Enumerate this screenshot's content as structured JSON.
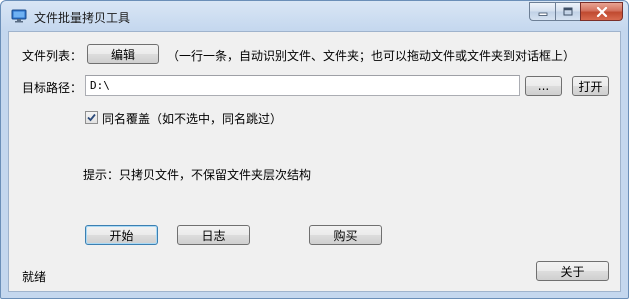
{
  "window": {
    "title": "文件批量拷贝工具"
  },
  "file_list": {
    "label": "文件列表：",
    "edit_button": "编辑",
    "hint": "（一行一条，自动识别文件、文件夹；也可以拖动文件或文件夹到对话框上）"
  },
  "target_path": {
    "label": "目标路径：",
    "value": "D:\\",
    "browse_button": "...",
    "open_button": "打开"
  },
  "overwrite": {
    "label": "同名覆盖（如不选中，同名跳过）",
    "checked": true
  },
  "tip": "提示：只拷贝文件，不保留文件夹层次结构",
  "actions": {
    "start": "开始",
    "log": "日志",
    "buy": "购买",
    "about": "关于"
  },
  "status": "就绪",
  "icons": {
    "app": "monitor-icon",
    "minimize": "minimize-icon",
    "maximize": "maximize-icon",
    "close": "close-icon",
    "check": "checkmark-icon"
  }
}
